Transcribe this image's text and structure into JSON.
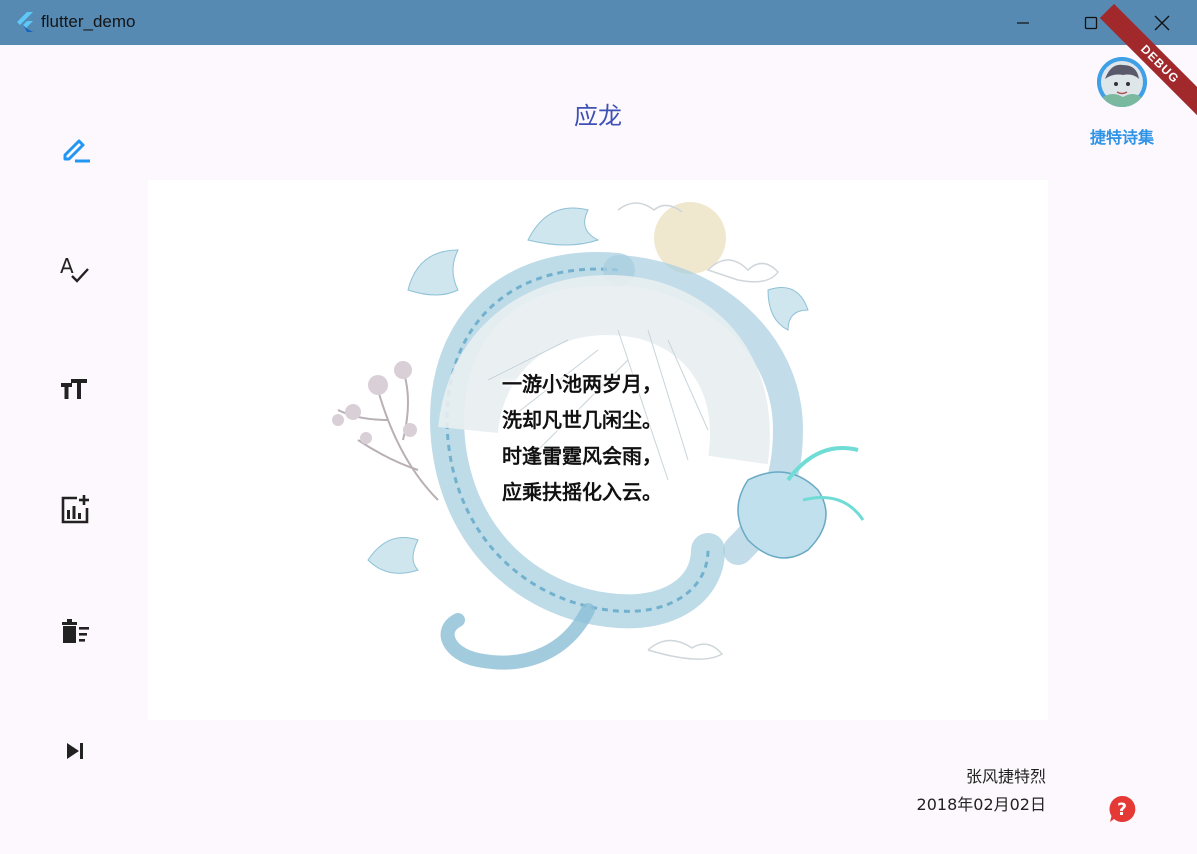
{
  "window": {
    "title": "flutter_demo"
  },
  "sidebar": {
    "items": [
      {
        "icon": "edit-icon",
        "active": true
      },
      {
        "icon": "spellcheck-icon",
        "active": false
      },
      {
        "icon": "text-size-icon",
        "active": false
      },
      {
        "icon": "add-chart-icon",
        "active": false
      },
      {
        "icon": "delete-sweep-icon",
        "active": false
      },
      {
        "icon": "skip-next-icon",
        "active": false
      }
    ]
  },
  "poem": {
    "title": "应龙",
    "lines": [
      "一游小池两岁月，",
      "洗却凡世几闲尘。",
      "时逢雷霆风会雨，",
      "应乘扶摇化入云。"
    ],
    "author": "张风捷特烈",
    "date": "2018年02月02日"
  },
  "profile": {
    "label": "捷特诗集"
  },
  "debug_banner": "DEBUG",
  "colors": {
    "titlebar": "#578ab3",
    "accent": "#2f93e6",
    "title": "#3f51b5",
    "help": "#e53935"
  }
}
